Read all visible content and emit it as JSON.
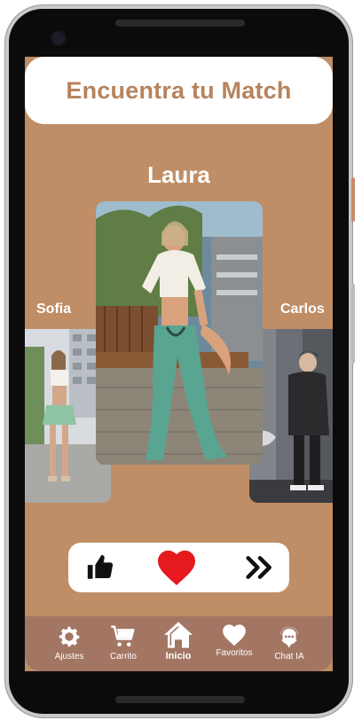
{
  "app": {
    "title": "Encuentra tu Match"
  },
  "profiles": {
    "current": {
      "name": "Laura"
    },
    "previous": {
      "name": "Sofia"
    },
    "next": {
      "name": "Carlos"
    }
  },
  "actions": [
    {
      "name": "like",
      "icon": "thumbs-up-icon"
    },
    {
      "name": "love",
      "icon": "heart-icon",
      "color": "#e5191e"
    },
    {
      "name": "skip",
      "icon": "double-chevron-right-icon"
    }
  ],
  "nav": {
    "items": [
      {
        "label": "Ajustes",
        "icon": "gear-icon"
      },
      {
        "label": "Carrito",
        "icon": "cart-icon"
      },
      {
        "label": "Inicio",
        "icon": "home-icon",
        "active": true
      },
      {
        "label": "Favoritos",
        "icon": "heart-icon"
      },
      {
        "label": "Chat IA",
        "icon": "chat-icon"
      }
    ]
  },
  "colors": {
    "background": "#bf8e66",
    "title": "#b7835d",
    "nav": "#a37664",
    "heart": "#e5191e"
  }
}
